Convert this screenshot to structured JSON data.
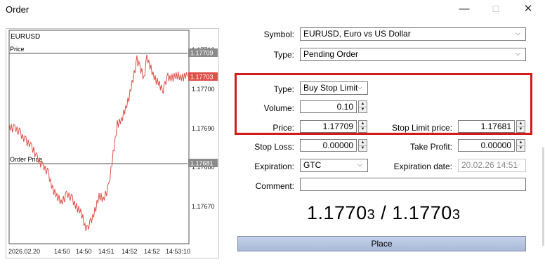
{
  "window": {
    "title": "Order",
    "minimize_icon": "—",
    "maximize_icon": "☐",
    "close_icon": "✕"
  },
  "chart": {
    "symbol": "EURUSD",
    "price_line_label": "Price",
    "order_price_line_label": "Order Price",
    "price_tag": "1.17709",
    "current_tag": "1.17703",
    "order_price_tag": "1.17681",
    "y_ticks": [
      "1.17710",
      "1.17700",
      "1.17690",
      "1.17680",
      "1.17670"
    ],
    "x_ticks": [
      "2026.02.20",
      "14:50",
      "14:50",
      "14:51",
      "14:52",
      "14:52",
      "14:53:10"
    ],
    "colors": {
      "line": "#e0504a",
      "tag_gray": "#8a8a8a",
      "tag_red": "#e0504a"
    }
  },
  "form": {
    "symbol": {
      "label": "Symbol:",
      "value": "EURUSD, Euro vs US Dollar"
    },
    "type": {
      "label": "Type:",
      "value": "Pending Order"
    },
    "order_type": {
      "label": "Type:",
      "value": "Buy Stop Limit"
    },
    "volume": {
      "label": "Volume:",
      "value": "0.10"
    },
    "price": {
      "label": "Price:",
      "value": "1.17709"
    },
    "stop_limit_price": {
      "label": "Stop Limit price:",
      "value": "1.17681"
    },
    "stop_loss": {
      "label": "Stop Loss:",
      "value": "0.00000"
    },
    "take_profit": {
      "label": "Take Profit:",
      "value": "0.00000"
    },
    "expiration": {
      "label": "Expiration:",
      "value": "GTC"
    },
    "expiration_date": {
      "label": "Expiration date:",
      "value": "20.02.26 14:51"
    },
    "comment": {
      "label": "Comment:",
      "value": ""
    }
  },
  "quote": {
    "bid_main": "1.1770",
    "bid_small": "3",
    "separator": " / ",
    "ask_main": "1.1770",
    "ask_small": "3"
  },
  "place_button": {
    "label": "Place"
  },
  "highlight_color": "#d11a1a"
}
